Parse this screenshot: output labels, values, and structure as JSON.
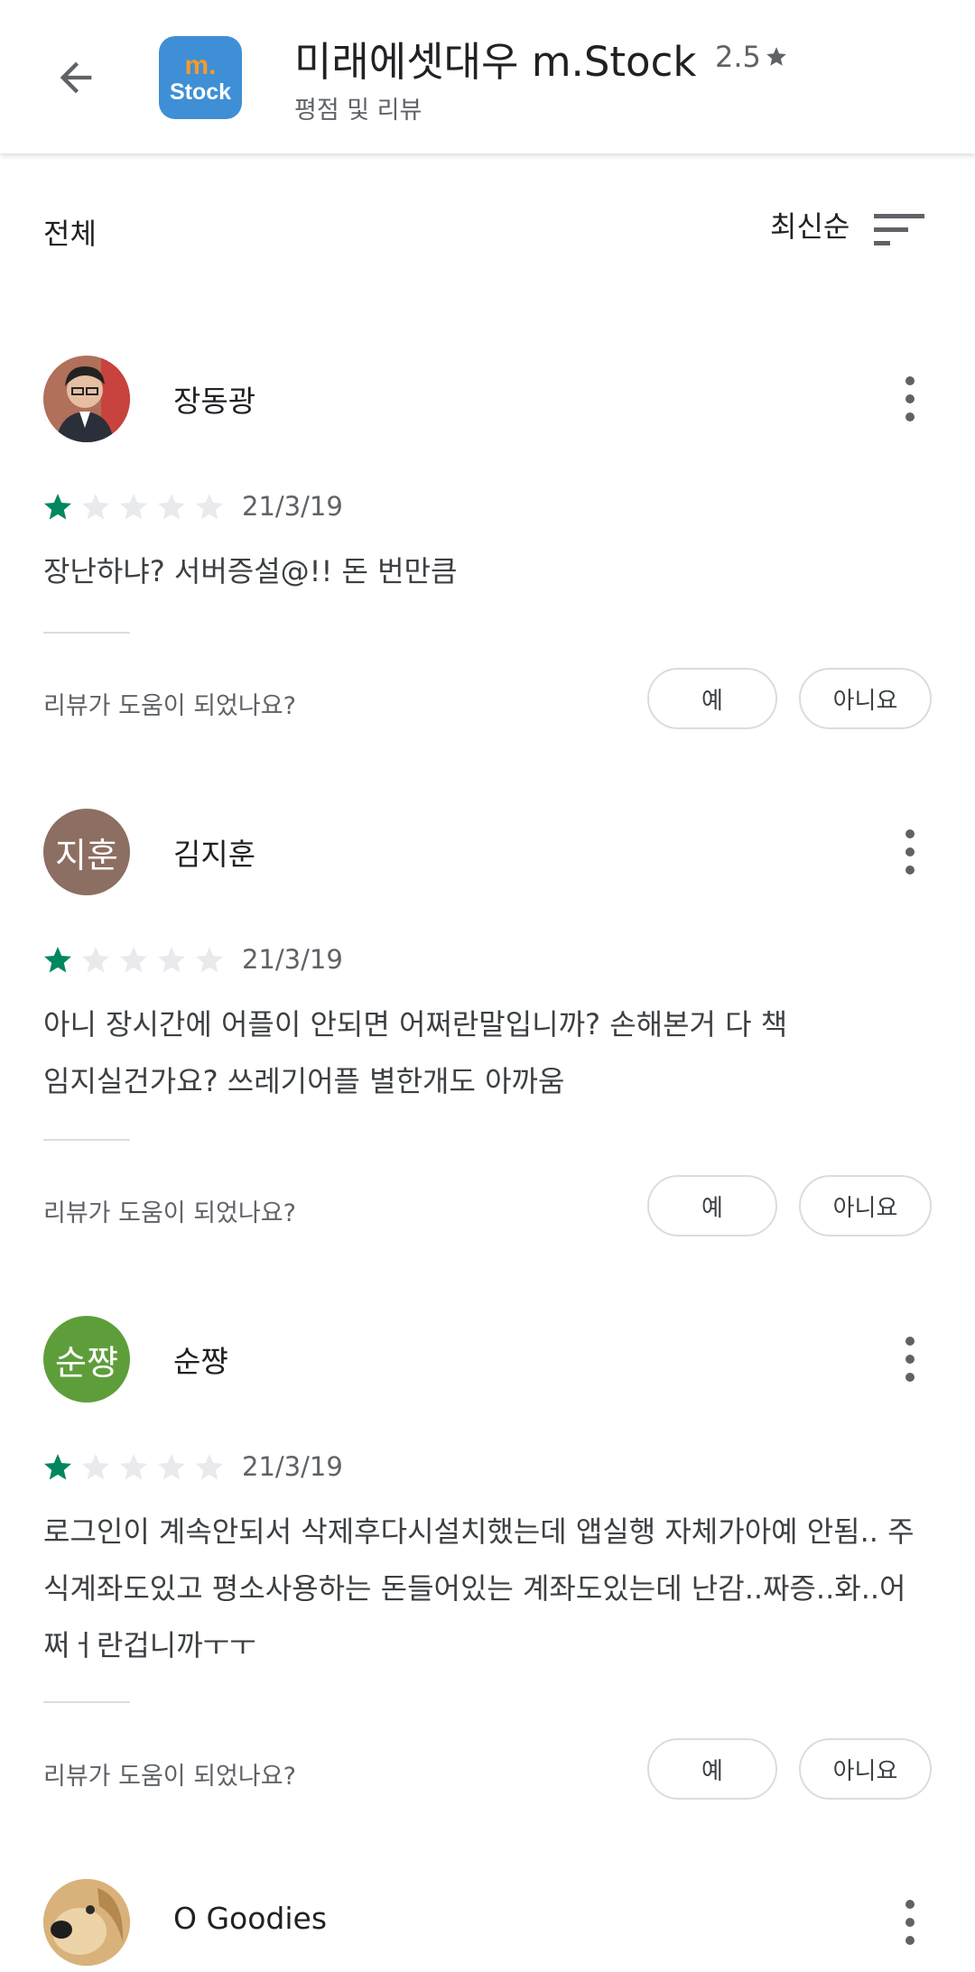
{
  "header": {
    "app_icon_top": "m.",
    "app_icon_bottom": "Stock",
    "title": "미래에셋대우 m.Stock",
    "rating": "2.5",
    "subtitle": "평점 및 리뷰"
  },
  "filter": {
    "label": "전체",
    "sort_label": "최신순"
  },
  "reviews": [
    {
      "author": "장동광",
      "avatar_text": "",
      "avatar_color": "#7a5a4a",
      "rating": 1,
      "date": "21/3/19",
      "text": "장난하냐? 서버증설@!! 돈 번만큼",
      "helpful_question": "리뷰가 도움이 되었나요?",
      "yes_label": "예",
      "no_label": "아니요"
    },
    {
      "author": "김지훈",
      "avatar_text": "지훈",
      "avatar_color": "#8d6e63",
      "rating": 1,
      "date": "21/3/19",
      "text": "아니 장시간에 어플이 안되면 어쩌란말입니까? 손해본거 다 책임지실건가요? 쓰레기어플 별한개도 아까움",
      "helpful_question": "리뷰가 도움이 되었나요?",
      "yes_label": "예",
      "no_label": "아니요"
    },
    {
      "author": "순쨩",
      "avatar_text": "순쨩",
      "avatar_color": "#5e9e3a",
      "rating": 1,
      "date": "21/3/19",
      "text": "로그인이 계속안되서 삭제후다시설치했는데 앱실행 자체가아예 안됨.. 주식계좌도있고 평소사용하는 돈들어있는 계좌도있는데 난감..짜증..화..어쩌ㅓ란겁니까ㅜㅜ",
      "helpful_question": "리뷰가 도움이 되었나요?",
      "yes_label": "예",
      "no_label": "아니요"
    },
    {
      "author": "O Goodies",
      "avatar_text": "",
      "avatar_color": "#c9a36a"
    }
  ],
  "colors": {
    "star_filled": "#01875f",
    "star_empty": "#e8eaed",
    "divider": "#dadce0"
  }
}
